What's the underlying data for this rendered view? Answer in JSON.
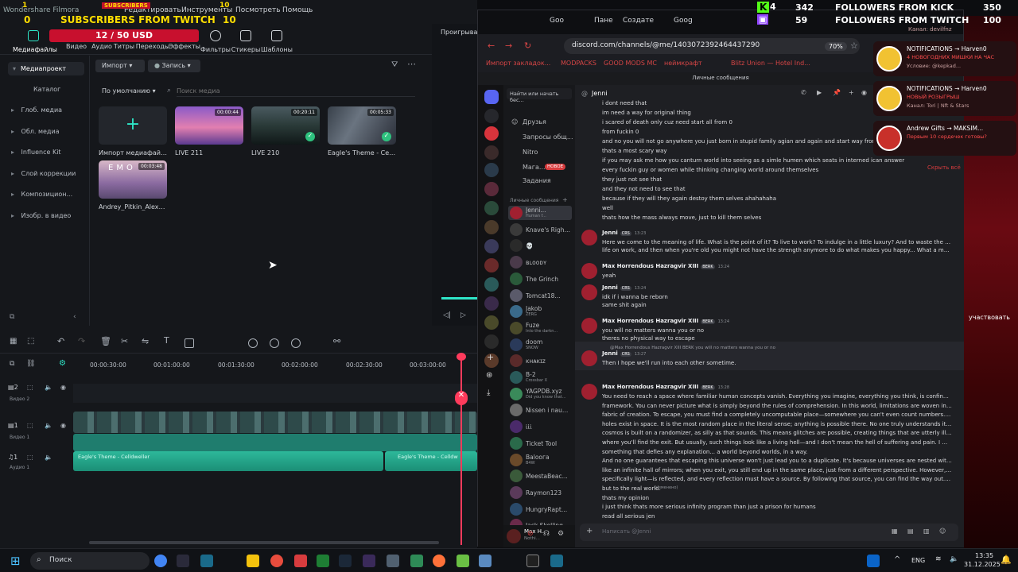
{
  "stream_overlay": {
    "subs_icon_label": "SUBSCRIBERS",
    "subs_count": "1",
    "subs_goal": "10",
    "twitch_subs_label": "SUBSCRIBERS FROM TWITCH",
    "twitch_subs_left": "0",
    "twitch_subs_right": "10",
    "kick_followers_label": "FOLLOWERS FROM KICK",
    "kick_badge": "4",
    "kick_count": "342",
    "kick_goal": "350",
    "twitch_followers_label": "FOLLOWERS FROM TWITCH",
    "twitch_badge": "59",
    "twitch_followers_goal": "100",
    "donation_goal": "12 / 50 USD",
    "notifications": [
      {
        "title": "NOTIFICATIONS → Harven0",
        "line2": "4 НОВОГОДНИХ МИШКИ НА ЧАС",
        "line3": "Условие:  @kepkad..."
      },
      {
        "title": "NOTIFICATIONS → Harven0",
        "line2": "НОВЫЙ РОЗЫГРЫШ",
        "line3": "Канал: Tori | Nft & Stars"
      },
      {
        "title": "Andrew Gifts → MAKSIM...",
        "line2": "Первым 10 сердечек готовы?",
        "line3": ""
      }
    ],
    "top_channel": "Канал: devilfnz",
    "hide_all": "Скрыть всё",
    "side_button": "участвовать"
  },
  "filmora": {
    "app_title": "Wondershare Filmora",
    "menu": [
      "Редактировать",
      "Инструменты",
      "Посмотреть",
      "Помощь"
    ],
    "toolbar_tabs": [
      "Медиафайлы",
      "Видео",
      "Аудио",
      "Титры",
      "Переходы",
      "Эффекты",
      "Фильтры",
      "Стикеры",
      "Шаблоны"
    ],
    "left_panel": [
      "Медиапроект",
      "Каталог",
      "Глоб. медиа",
      "Обл. медиа",
      "Influence Kit",
      "Слой коррекции",
      "Композицион...",
      "Изобр. в видео"
    ],
    "import_label": "Импорт",
    "record_label": "Запись",
    "sort_label": "По умолчанию",
    "search_placeholder": "Поиск медиа",
    "import_tile_label": "Импорт медиафайлов",
    "media": [
      {
        "name": "LIVE 211",
        "duration": "00:00:44"
      },
      {
        "name": "LIVE 210",
        "duration": "00:20:11"
      },
      {
        "name": "Eagle's Theme - Celld...",
        "duration": "00:05:33"
      },
      {
        "name": "Andrey_Pitkin_Alexan...",
        "duration": "00:03:48"
      }
    ],
    "preview_label": "Проигрыват",
    "timecodes": [
      "00:00:30:00",
      "00:01:00:00",
      "00:01:30:00",
      "00:02:00:00",
      "00:02:30:00",
      "00:03:00:00"
    ],
    "tracks": [
      {
        "num": "2",
        "name": "Видео 2"
      },
      {
        "num": "1",
        "name": "Видео 1"
      },
      {
        "num": "1",
        "name": "Аудио 1"
      }
    ],
    "audio_clip_names": [
      "Eagle's Theme - Celldweller",
      "Eagle's Theme - Celldw"
    ]
  },
  "browser": {
    "tabs": [
      "Goo",
      "Пане",
      "Создате",
      "Goog"
    ],
    "url": "discord.com/channels/@me/1403072392464437290",
    "zoom": "70%",
    "bookmarks": [
      "Импорт закладок...",
      "MODPACKS",
      "GOOD MODS MC",
      "неймкрафт",
      "Blitz Union — Hotel Ind..."
    ]
  },
  "discord": {
    "top_bar": "Личные сообщения",
    "search_placeholder": "Найти или начать бес...",
    "current_dm": "Jenni",
    "nav": [
      "Друзья",
      "Запросы общ...",
      "Nitro",
      "Мага...",
      "Задания"
    ],
    "new_badge": "НОВОЕ",
    "dm_header": "Личные сообщения",
    "dms": [
      {
        "name": "Jenni...",
        "sub": "Human f..."
      },
      {
        "name": "Knave's Right...",
        "sub": ""
      },
      {
        "name": "💀",
        "sub": ""
      },
      {
        "name": "ʙʟᴏᴏᴅʏ",
        "sub": ""
      },
      {
        "name": "The Grinch",
        "sub": ""
      },
      {
        "name": "Tomcat18...",
        "sub": ""
      },
      {
        "name": "Jakob",
        "sub": "ZERG"
      },
      {
        "name": "Fuze",
        "sub": "Into the darkn..."
      },
      {
        "name": "doom",
        "sub": "SNOW"
      },
      {
        "name": "ᴋʜᴀᴋɪᴢ",
        "sub": ""
      },
      {
        "name": "B-2",
        "sub": "Crossbar X"
      },
      {
        "name": "YAGPDB.xyz",
        "sub": "Did you know that..."
      },
      {
        "name": "Nissen i naus...",
        "sub": ""
      },
      {
        "name": "ι̇ι̇ι̇",
        "sub": ""
      },
      {
        "name": "Ticket Tool",
        "sub": ""
      },
      {
        "name": "Baloога",
        "sub": "B4W"
      },
      {
        "name": "MeestaBeac...",
        "sub": ""
      },
      {
        "name": "Raymon123",
        "sub": ""
      },
      {
        "name": "HungryRapto...",
        "sub": ""
      },
      {
        "name": "Jack Skelling...",
        "sub": ""
      }
    ],
    "user_name": "Max H...",
    "user_status": "Nothi...",
    "message_input_placeholder": "Написать @Jenni",
    "messages_top": [
      "i dont need that",
      "im need a way for original thing",
      "i scared of death only cuz need start all from 0",
      "from fuckin 0",
      "and no you will not go anywhere you just born in stupid family agian and again and start way from school to",
      "thats a most scary way",
      "if you may ask me how you canturn world into seeing as a simle humen which seats in interned  ican answer",
      "every fuckin guy or women while thinking changing world around themselves",
      "they just not see that",
      "and they not need to see that",
      "because if they will they again destoy them selves ahahahaha",
      "well",
      "thats how the mass always move, just to kill them selves"
    ],
    "msg_groups": [
      {
        "author": "Jenni",
        "tag": "CRS",
        "time": "13:23",
        "lines": [
          "Here we come to the meaning of life. What is the point of it? To live to work? To indulge in a little luxury? And to waste the best time of your",
          "life on work, and then when you're old you might not have the strength anymore to do what makes you happy... What a messed-up cycle!"
        ]
      },
      {
        "author": "Max Horrendous Hazragvir XIII",
        "tag": "BERK",
        "time": "13:24",
        "lines": [
          "yeah"
        ]
      },
      {
        "author": "Jenni",
        "tag": "CRS",
        "time": "13:24",
        "lines": [
          "idk if i wanna be reborn",
          "same shit again"
        ]
      },
      {
        "author": "Max Horrendous Hazragvir XIII",
        "tag": "BERK",
        "time": "13:24",
        "lines": [
          "you will no matters wanna you or no",
          "theres no physical way to escape"
        ]
      },
      {
        "author": "Jenni",
        "tag": "CRS",
        "time": "13:27",
        "lines": [
          "Then I hope we'll run into each other sometime."
        ]
      },
      {
        "author": "Max Horrendous Hazragvir XIII",
        "tag": "BERK",
        "time": "13:28",
        "lines": [
          "You need to reach a space where familiar human concepts vanish. Everything you imagine, everything you think, is confined within a",
          "framework. You can never picture what is simply beyond the rules of comprehension. In this world, limitations are woven into the very",
          "fabric of creation. To escape, you must find a completely uncomputable place—somewhere you can't even count numbers. I'm certain such",
          "holes exist in space. It is the most random place in the literal sense; anything is possible there. No one truly understands it, but I believe the",
          "cosmos is built on a randomizer, as silly as that sounds. This means glitches are possible, creating things that are utterly illogical. That is",
          "where you'll find the exit. But usually, such things look like a living hell—and I don't mean the hell of suffering and pain. I mean it's",
          "something that defies any explanation... a world beyond worlds, in a way.",
          "And no one guarantees that escaping this universe won't just lead you to a duplicate. It's because universes are nested within one another",
          "like an infinite hall of mirrors; when you exit, you still end up in the same place, just from a different perspective. However, light—",
          "specifically light—is reflected, and every reflection must have a source. By following that source, you can find the way out. Not to heaven,",
          "but to the real world.",
          "thats my opinion",
          "i just think thats more serious infinity program than just a prison for humans",
          "read all serious jen"
        ]
      }
    ],
    "reply_preview": "@Max Horrendous Hazragvir XIII  BERK  you will no matters wanna you or no",
    "edited_label": "(изменено)"
  },
  "taskbar": {
    "search_label": "Поиск",
    "lang": "ENG",
    "time": "13:35",
    "date": "31.12.2025"
  }
}
